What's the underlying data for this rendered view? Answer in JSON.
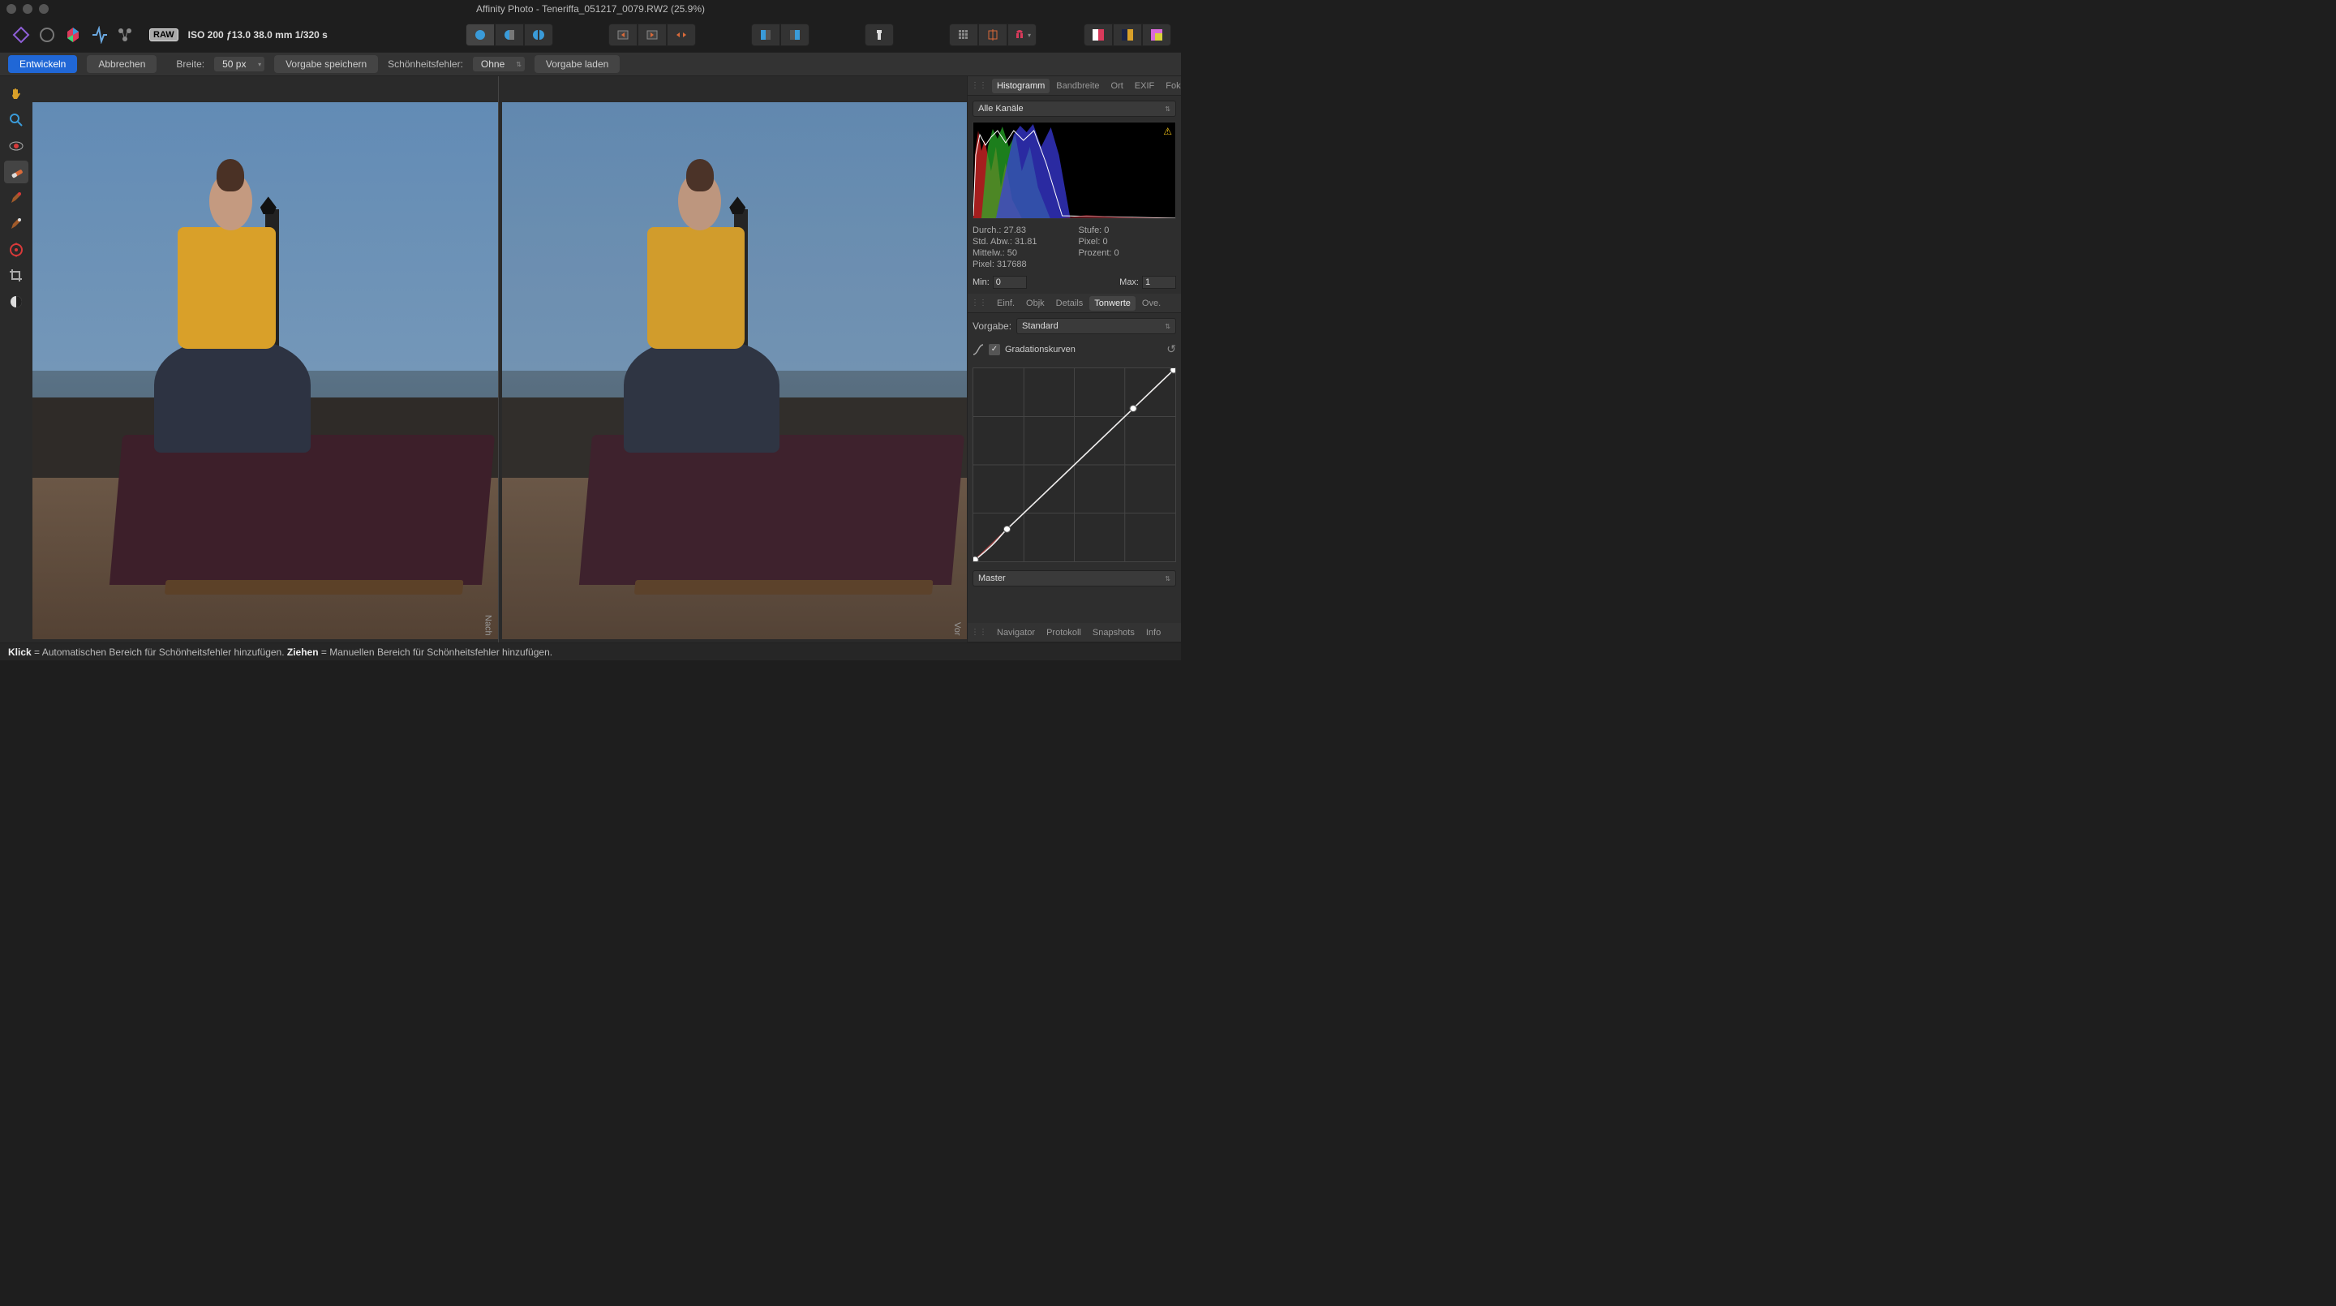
{
  "window": {
    "title": "Affinity Photo - Teneriffa_051217_0079.RW2 (25.9%)"
  },
  "raw_badge": "RAW",
  "raw_info": "ISO 200 ƒ13.0 38.0 mm 1/320 s",
  "context_bar": {
    "develop": "Entwickeln",
    "cancel": "Abbrechen",
    "width_label": "Breite:",
    "width_value": "50 px",
    "save_preset": "Vorgabe speichern",
    "blemish_label": "Schönheitsfehler:",
    "blemish_value": "Ohne",
    "load_preset": "Vorgabe laden"
  },
  "tools": [
    "hand",
    "zoom",
    "redeye",
    "blemish",
    "overlay-paint",
    "overlay-erase",
    "overlay-grad",
    "crop",
    "whitebalance"
  ],
  "panes": {
    "after": "Nach",
    "before": "Vor"
  },
  "panel_tabs_top": [
    "Histogramm",
    "Bandbreite",
    "Ort",
    "EXIF",
    "Fokus"
  ],
  "histogram": {
    "channel_select": "Alle Kanäle",
    "stats": {
      "mean": "Durch.: 27.83",
      "stddev": "Std. Abw.: 31.81",
      "median": "Mittelw.: 50",
      "pixels": "Pixel: 317688",
      "level": "Stufe: 0",
      "pixel0": "Pixel: 0",
      "percent": "Prozent: 0"
    },
    "min_label": "Min:",
    "min_value": "0",
    "max_label": "Max:",
    "max_value": "1"
  },
  "panel_tabs_mid": [
    "Einf.",
    "Objk",
    "Details",
    "Tonwerte",
    "Ove."
  ],
  "preset_label": "Vorgabe:",
  "preset_value": "Standard",
  "curves": {
    "section_label": "Gradationskurven",
    "master": "Master"
  },
  "panel_tabs_bottom": [
    "Navigator",
    "Protokoll",
    "Snapshots",
    "Info"
  ],
  "status_bar": {
    "click_bold": "Klick",
    "click_rest": " = Automatischen Bereich für Schönheitsfehler hinzufügen. ",
    "drag_bold": "Ziehen",
    "drag_rest": " = Manuellen Bereich für Schönheitsfehler hinzufügen."
  }
}
